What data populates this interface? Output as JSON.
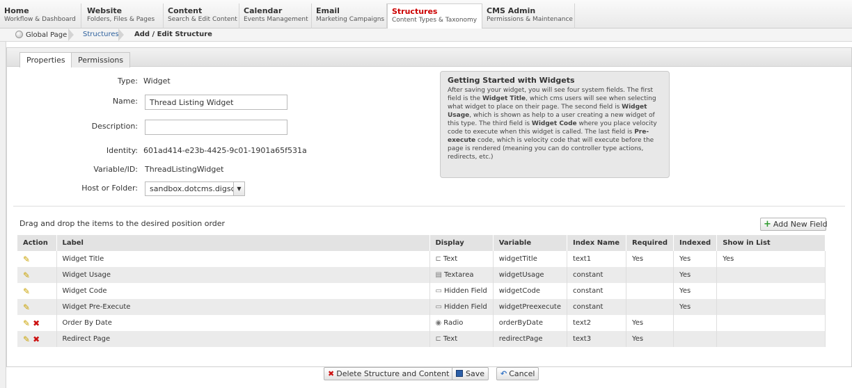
{
  "nav": {
    "tabs": [
      {
        "title": "Home",
        "sub": "Workflow & Dashboard"
      },
      {
        "title": "Website",
        "sub": "Folders, Files & Pages"
      },
      {
        "title": "Content",
        "sub": "Search & Edit Content"
      },
      {
        "title": "Calendar",
        "sub": "Events Management"
      },
      {
        "title": "Email",
        "sub": "Marketing Campaigns"
      },
      {
        "title": "Structures",
        "sub": "Content Types & Taxonomy"
      },
      {
        "title": "CMS Admin",
        "sub": "Permissions & Maintenance"
      }
    ],
    "active_index": 5
  },
  "breadcrumb": {
    "home": "Global Page",
    "parent": "Structures",
    "current": "Add / Edit Structure"
  },
  "panel_tabs": {
    "properties": "Properties",
    "permissions": "Permissions"
  },
  "form": {
    "type_label": "Type:",
    "type_value": "Widget",
    "name_label": "Name:",
    "name_value": "Thread Listing Widget",
    "description_label": "Description:",
    "description_value": "",
    "identity_label": "Identity:",
    "identity_value": "601ad414-e23b-4425-9c01-1901a65f531a",
    "variable_label": "Variable/ID:",
    "variable_value": "ThreadListingWidget",
    "host_label": "Host or Folder:",
    "host_value": "sandbox.dotcms.digsc"
  },
  "help": {
    "title": "Getting Started with Widgets",
    "p1": "After saving your widget, you will see four system fields. The first field is the ",
    "b1": "Widget Title",
    "p2": ", which cms users will see when selecting what widget to place on their page. The second field is ",
    "b2": "Widget Usage",
    "p3": ", which is shown as help to a user creating a new widget of this type. The third field is ",
    "b3": "Widget Code",
    "p4": " where you place velocity code to execute when this widget is called. The last field is ",
    "b4": "Pre-execute",
    "p5": " code, which is velocity code that will execute before the page is rendered (meaning you can do controller type actions, redirects, etc.)"
  },
  "fields_section": {
    "drag_note": "Drag and drop the items to the desired position order",
    "add_button": "Add New Field",
    "columns": [
      "Action",
      "Label",
      "Display",
      "Variable",
      "Index Name",
      "Required",
      "Indexed",
      "Show in List"
    ],
    "rows": [
      {
        "deletable": false,
        "label": "Widget Title",
        "display": "Text",
        "display_icon": "text-field-icon",
        "variable": "widgetTitle",
        "index": "text1",
        "required": "Yes",
        "indexed": "Yes",
        "show": "Yes"
      },
      {
        "deletable": false,
        "label": "Widget Usage",
        "display": "Textarea",
        "display_icon": "textarea-icon",
        "variable": "widgetUsage",
        "index": "constant",
        "required": "",
        "indexed": "Yes",
        "show": ""
      },
      {
        "deletable": false,
        "label": "Widget Code",
        "display": "Hidden Field",
        "display_icon": "hidden-field-icon",
        "variable": "widgetCode",
        "index": "constant",
        "required": "",
        "indexed": "Yes",
        "show": ""
      },
      {
        "deletable": false,
        "label": "Widget Pre-Execute",
        "display": "Hidden Field",
        "display_icon": "hidden-field-icon",
        "variable": "widgetPreexecute",
        "index": "constant",
        "required": "",
        "indexed": "Yes",
        "show": ""
      },
      {
        "deletable": true,
        "label": "Order By Date",
        "display": "Radio",
        "display_icon": "radio-icon",
        "variable": "orderByDate",
        "index": "text2",
        "required": "Yes",
        "indexed": "",
        "show": ""
      },
      {
        "deletable": true,
        "label": "Redirect Page",
        "display": "Text",
        "display_icon": "text-field-icon",
        "variable": "redirectPage",
        "index": "text3",
        "required": "Yes",
        "indexed": "",
        "show": ""
      }
    ]
  },
  "footer": {
    "delete": "Delete Structure and Content",
    "save": "Save",
    "cancel": "Cancel"
  }
}
